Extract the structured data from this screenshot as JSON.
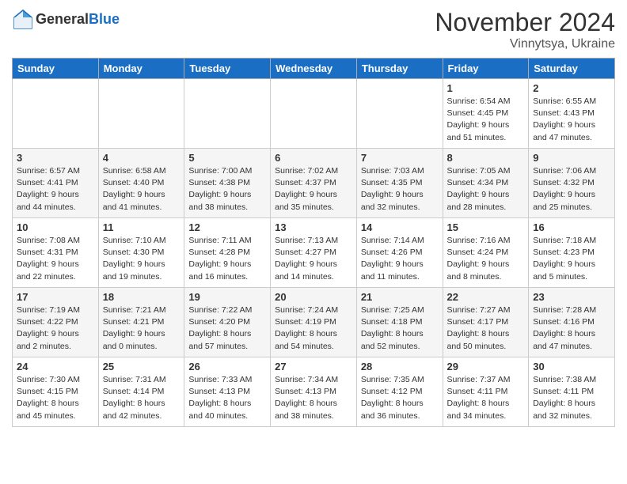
{
  "header": {
    "logo_general": "General",
    "logo_blue": "Blue",
    "title": "November 2024",
    "location": "Vinnytsya, Ukraine"
  },
  "days_of_week": [
    "Sunday",
    "Monday",
    "Tuesday",
    "Wednesday",
    "Thursday",
    "Friday",
    "Saturday"
  ],
  "weeks": [
    [
      {
        "day": "",
        "info": ""
      },
      {
        "day": "",
        "info": ""
      },
      {
        "day": "",
        "info": ""
      },
      {
        "day": "",
        "info": ""
      },
      {
        "day": "",
        "info": ""
      },
      {
        "day": "1",
        "info": "Sunrise: 6:54 AM\nSunset: 4:45 PM\nDaylight: 9 hours and 51 minutes."
      },
      {
        "day": "2",
        "info": "Sunrise: 6:55 AM\nSunset: 4:43 PM\nDaylight: 9 hours and 47 minutes."
      }
    ],
    [
      {
        "day": "3",
        "info": "Sunrise: 6:57 AM\nSunset: 4:41 PM\nDaylight: 9 hours and 44 minutes."
      },
      {
        "day": "4",
        "info": "Sunrise: 6:58 AM\nSunset: 4:40 PM\nDaylight: 9 hours and 41 minutes."
      },
      {
        "day": "5",
        "info": "Sunrise: 7:00 AM\nSunset: 4:38 PM\nDaylight: 9 hours and 38 minutes."
      },
      {
        "day": "6",
        "info": "Sunrise: 7:02 AM\nSunset: 4:37 PM\nDaylight: 9 hours and 35 minutes."
      },
      {
        "day": "7",
        "info": "Sunrise: 7:03 AM\nSunset: 4:35 PM\nDaylight: 9 hours and 32 minutes."
      },
      {
        "day": "8",
        "info": "Sunrise: 7:05 AM\nSunset: 4:34 PM\nDaylight: 9 hours and 28 minutes."
      },
      {
        "day": "9",
        "info": "Sunrise: 7:06 AM\nSunset: 4:32 PM\nDaylight: 9 hours and 25 minutes."
      }
    ],
    [
      {
        "day": "10",
        "info": "Sunrise: 7:08 AM\nSunset: 4:31 PM\nDaylight: 9 hours and 22 minutes."
      },
      {
        "day": "11",
        "info": "Sunrise: 7:10 AM\nSunset: 4:30 PM\nDaylight: 9 hours and 19 minutes."
      },
      {
        "day": "12",
        "info": "Sunrise: 7:11 AM\nSunset: 4:28 PM\nDaylight: 9 hours and 16 minutes."
      },
      {
        "day": "13",
        "info": "Sunrise: 7:13 AM\nSunset: 4:27 PM\nDaylight: 9 hours and 14 minutes."
      },
      {
        "day": "14",
        "info": "Sunrise: 7:14 AM\nSunset: 4:26 PM\nDaylight: 9 hours and 11 minutes."
      },
      {
        "day": "15",
        "info": "Sunrise: 7:16 AM\nSunset: 4:24 PM\nDaylight: 9 hours and 8 minutes."
      },
      {
        "day": "16",
        "info": "Sunrise: 7:18 AM\nSunset: 4:23 PM\nDaylight: 9 hours and 5 minutes."
      }
    ],
    [
      {
        "day": "17",
        "info": "Sunrise: 7:19 AM\nSunset: 4:22 PM\nDaylight: 9 hours and 2 minutes."
      },
      {
        "day": "18",
        "info": "Sunrise: 7:21 AM\nSunset: 4:21 PM\nDaylight: 9 hours and 0 minutes."
      },
      {
        "day": "19",
        "info": "Sunrise: 7:22 AM\nSunset: 4:20 PM\nDaylight: 8 hours and 57 minutes."
      },
      {
        "day": "20",
        "info": "Sunrise: 7:24 AM\nSunset: 4:19 PM\nDaylight: 8 hours and 54 minutes."
      },
      {
        "day": "21",
        "info": "Sunrise: 7:25 AM\nSunset: 4:18 PM\nDaylight: 8 hours and 52 minutes."
      },
      {
        "day": "22",
        "info": "Sunrise: 7:27 AM\nSunset: 4:17 PM\nDaylight: 8 hours and 50 minutes."
      },
      {
        "day": "23",
        "info": "Sunrise: 7:28 AM\nSunset: 4:16 PM\nDaylight: 8 hours and 47 minutes."
      }
    ],
    [
      {
        "day": "24",
        "info": "Sunrise: 7:30 AM\nSunset: 4:15 PM\nDaylight: 8 hours and 45 minutes."
      },
      {
        "day": "25",
        "info": "Sunrise: 7:31 AM\nSunset: 4:14 PM\nDaylight: 8 hours and 42 minutes."
      },
      {
        "day": "26",
        "info": "Sunrise: 7:33 AM\nSunset: 4:13 PM\nDaylight: 8 hours and 40 minutes."
      },
      {
        "day": "27",
        "info": "Sunrise: 7:34 AM\nSunset: 4:13 PM\nDaylight: 8 hours and 38 minutes."
      },
      {
        "day": "28",
        "info": "Sunrise: 7:35 AM\nSunset: 4:12 PM\nDaylight: 8 hours and 36 minutes."
      },
      {
        "day": "29",
        "info": "Sunrise: 7:37 AM\nSunset: 4:11 PM\nDaylight: 8 hours and 34 minutes."
      },
      {
        "day": "30",
        "info": "Sunrise: 7:38 AM\nSunset: 4:11 PM\nDaylight: 8 hours and 32 minutes."
      }
    ]
  ]
}
